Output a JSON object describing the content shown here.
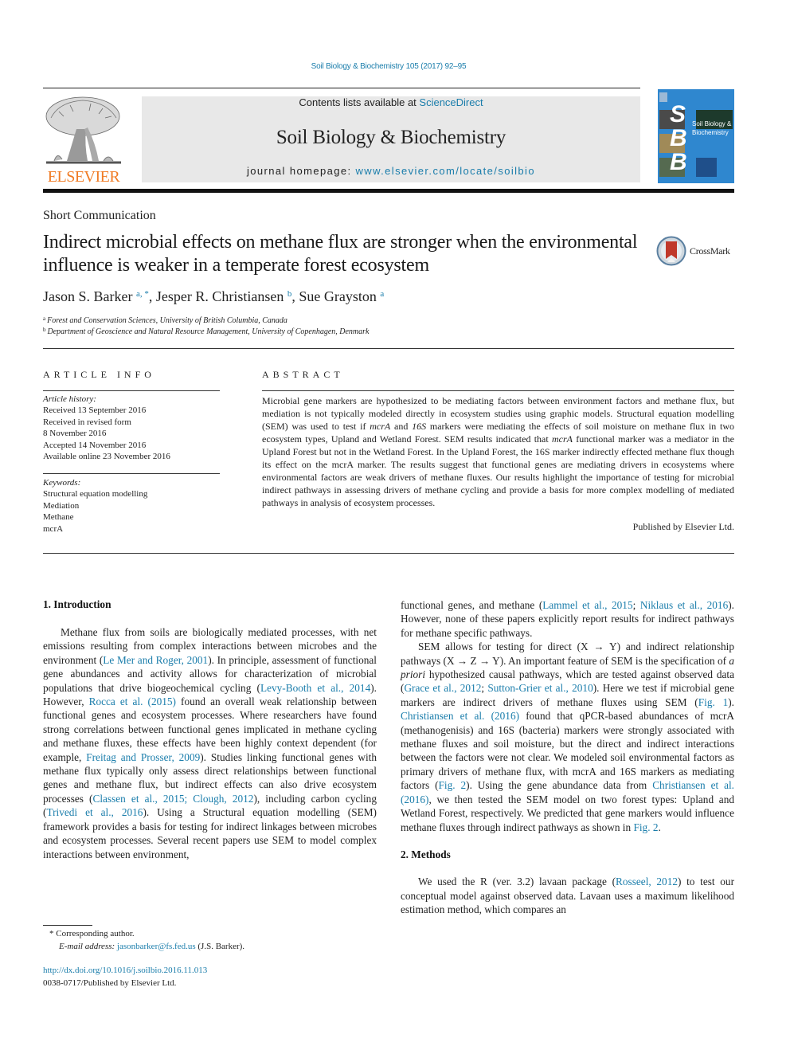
{
  "header": {
    "journal_ref": "Soil Biology & Biochemistry 105 (2017) 92–95",
    "contents_prefix": "Contents lists available at ",
    "contents_link": "ScienceDirect",
    "journal_title": "Soil Biology & Biochemistry",
    "homepage_prefix": "journal homepage: ",
    "homepage_link": "www.elsevier.com/locate/soilbio",
    "publisher_logo_text": "ELSEVIER",
    "cover": {
      "letters": [
        "S",
        "B",
        "B"
      ],
      "caption_line1": "Soil Biology &",
      "caption_line2": "Biochemistry",
      "color": "#2f87cf"
    },
    "brand_orange": "#f07b24",
    "link_color": "#1a7dab"
  },
  "article": {
    "type": "Short Communication",
    "title": "Indirect microbial effects on methane flux are stronger when the environmental influence is weaker in a temperate forest ecosystem",
    "crossmark_label": "CrossMark",
    "authors": [
      {
        "name": "Jason S. Barker",
        "sup": "a, *"
      },
      {
        "name": "Jesper R. Christiansen",
        "sup": "b"
      },
      {
        "name": "Sue Grayston",
        "sup": "a"
      }
    ],
    "affiliations": [
      {
        "key": "a",
        "text": "Forest and Conservation Sciences, University of British Columbia, Canada"
      },
      {
        "key": "b",
        "text": "Department of Geoscience and Natural Resource Management, University of Copenhagen, Denmark"
      }
    ]
  },
  "article_info": {
    "heading": "ARTICLE INFO",
    "history_label": "Article history:",
    "history": [
      "Received 13 September 2016",
      "Received in revised form",
      "8 November 2016",
      "Accepted 14 November 2016",
      "Available online 23 November 2016"
    ],
    "keywords_label": "Keywords:",
    "keywords": [
      "Structural equation modelling",
      "Mediation",
      "Methane",
      "mcrA"
    ]
  },
  "abstract": {
    "heading": "ABSTRACT",
    "text_parts": [
      "Microbial gene markers are hypothesized to be mediating factors between environment factors and methane flux, but mediation is not typically modeled directly in ecosystem studies using graphic models. Structural equation modelling (SEM) was used to test if ",
      "mcrA",
      " and ",
      "16S",
      " markers were mediating the effects of soil moisture on methane flux in two ecosystem types, Upland and Wetland Forest. SEM results indicated that ",
      "mcrA",
      " functional marker was a mediator in the Upland Forest but not in the Wetland Forest. In the Upland Forest, the 16S marker indirectly effected methane flux though its effect on the mcrA marker. The results suggest that functional genes are mediating drivers in ecosystems where environmental factors are weak drivers of methane fluxes. Our results highlight the importance of testing for microbial indirect pathways in assessing drivers of methane cycling and provide a basis for more complex modelling of mediated pathways in analysis of ecosystem processes."
    ],
    "published_by": "Published by Elsevier Ltd."
  },
  "body": {
    "intro_heading": "1.  Introduction",
    "intro_p1": [
      {
        "t": "Methane flux from soils are biologically mediated processes, with net emissions resulting from complex interactions between microbes and the environment ("
      },
      {
        "t": "Le Mer and Roger, 2001",
        "link": true
      },
      {
        "t": "). In principle, assessment of functional gene abundances and activity allows for characterization of microbial populations that drive biogeochemical cycling ("
      },
      {
        "t": "Levy-Booth et al., 2014",
        "link": true
      },
      {
        "t": "). However, "
      },
      {
        "t": "Rocca et al. (2015)",
        "link": true
      },
      {
        "t": " found an overall weak relationship between functional genes and ecosystem processes. Where researchers have found strong correlations between functional genes implicated in methane cycling and methane fluxes, these effects have been highly context dependent (for example, "
      },
      {
        "t": "Freitag and Prosser, 2009",
        "link": true
      },
      {
        "t": "). Studies linking functional genes with methane flux typically only assess direct relationships between functional genes and methane flux, but indirect effects can also drive ecosystem processes ("
      },
      {
        "t": "Classen et al., 2015; Clough, 2012",
        "link": true
      },
      {
        "t": "), including carbon cycling ("
      },
      {
        "t": "Trivedi et al., 2016",
        "link": true
      },
      {
        "t": "). Using a Structural equation modelling (SEM) framework provides a basis for testing for indirect linkages between microbes and ecosystem processes. Several recent papers use SEM to model complex interactions between environment, functional genes, and methane ("
      },
      {
        "t": "Lammel et al., 2015",
        "link": true
      },
      {
        "t": "; "
      },
      {
        "t": "Niklaus et al., 2016",
        "link": true
      },
      {
        "t": "). However, none of these papers explicitly report results for indirect pathways for methane specific pathways."
      }
    ],
    "intro_p2": [
      {
        "t": "SEM allows for testing for direct (X → Y) and indirect relationship pathways (X → Z → Y). An important feature of SEM is the specification of "
      },
      {
        "t": "a priori",
        "italic": true
      },
      {
        "t": " hypothesized causal pathways, which are tested against observed data ("
      },
      {
        "t": "Grace et al., 2012",
        "link": true
      },
      {
        "t": "; "
      },
      {
        "t": "Sutton-Grier et al., 2010",
        "link": true
      },
      {
        "t": "). Here we test if microbial gene markers are indirect drivers of methane fluxes using SEM ("
      },
      {
        "t": "Fig. 1",
        "link": true
      },
      {
        "t": "). "
      },
      {
        "t": "Christiansen et al. (2016)",
        "link": true
      },
      {
        "t": " found that qPCR-based abundances of mcrA (methanogenisis) and 16S (bacteria) markers were strongly associated with methane fluxes and soil moisture, but the direct and indirect interactions between the factors were not clear. We modeled soil environmental factors as primary drivers of methane flux, with mcrA and 16S markers as mediating factors ("
      },
      {
        "t": "Fig. 2",
        "link": true
      },
      {
        "t": "). Using the gene abundance data from "
      },
      {
        "t": "Christiansen et al. (2016)",
        "link": true
      },
      {
        "t": ", we then tested the SEM model on two forest types: Upland and Wetland Forest, respectively. We predicted that gene markers would influence methane fluxes through indirect pathways as shown in "
      },
      {
        "t": "Fig. 2",
        "link": true
      },
      {
        "t": "."
      }
    ],
    "methods_heading": "2.  Methods",
    "methods_p1": [
      {
        "t": "We used the R (ver. 3.2) lavaan package ("
      },
      {
        "t": "Rosseel, 2012",
        "link": true
      },
      {
        "t": ") to test our conceptual model against observed data. Lavaan uses a maximum likelihood estimation method, which compares an"
      }
    ]
  },
  "footnotes": {
    "corresponding": "*  Corresponding author.",
    "email_label": "E-mail address: ",
    "email": "jasonbarker@fs.fed.us",
    "email_suffix": " (J.S. Barker).",
    "doi": "http://dx.doi.org/10.1016/j.soilbio.2016.11.013",
    "issn": "0038-0717/Published by Elsevier Ltd."
  }
}
